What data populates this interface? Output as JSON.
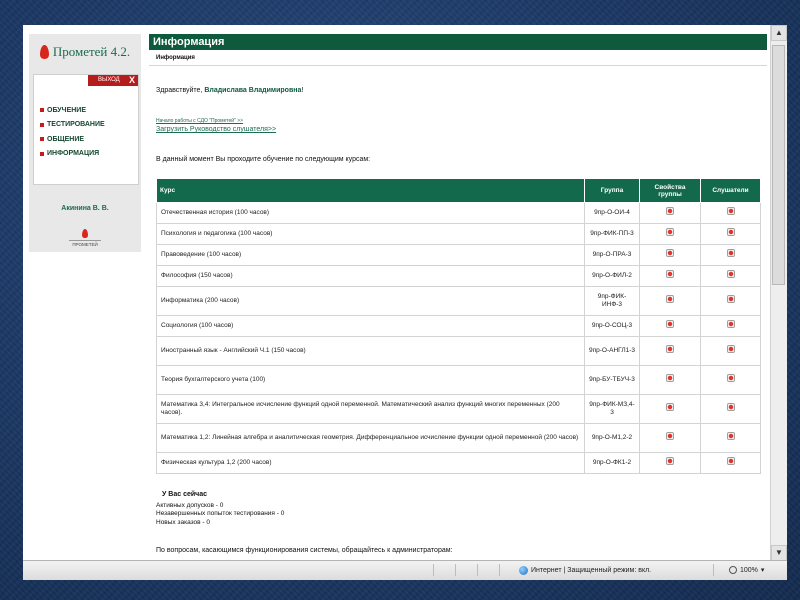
{
  "app": {
    "logo_text": "Прометей 4.2.",
    "small_logo_text": "ПРОМЕТЕЙ"
  },
  "sidebar": {
    "exit_label": "ВЫХОД",
    "exit_x": "X",
    "items": [
      {
        "label": "ОБУЧЕНИЕ"
      },
      {
        "label": "ТЕСТИРОВАНИЕ"
      },
      {
        "label": "ОБЩЕНИЕ"
      },
      {
        "label": "ИНФОРМАЦИЯ"
      }
    ],
    "user_name": "Акинина В. В."
  },
  "main": {
    "header_title": "Информация",
    "breadcrumb": "Информация",
    "greeting_prefix": "Здравствуйте, ",
    "greeting_name": "Владислава Владимировна",
    "greeting_suffix": "!",
    "link_start": "Начало работы с СДО \"Прометей\" >>",
    "link_guide": "Загрузить Руководство слушателя>>",
    "intro": "В данный момент Вы проходите обучение по следующим курсам:",
    "table": {
      "headers": {
        "course": "Курс",
        "group": "Группа",
        "group_props": "Свойства группы",
        "listeners": "Слушатели"
      },
      "rows": [
        {
          "course": "Отечественная история (100 часов)",
          "group": "9пр-О-ОИ-4"
        },
        {
          "course": "Психология и педагогика (100 часов)",
          "group": "9пр-ФИК-ПП-3"
        },
        {
          "course": "Правоведение (100 часов)",
          "group": "9пр-О-ПРА-3"
        },
        {
          "course": "Философия (150 часов)",
          "group": "9пр-О-ФИЛ-2"
        },
        {
          "course": "Информатика (200 часов)",
          "group": "9пр-ФИК-ИНФ-3"
        },
        {
          "course": "Социология (100 часов)",
          "group": "9пр-О-СОЦ-3"
        },
        {
          "course": "Иностранный язык - Английский Ч.1 (150 часов)",
          "group": "9пр-О-АНГЛ1-3"
        },
        {
          "course": "Теория бухгалтерского учета (100)",
          "group": "9пр-БУ-ТБУЧ-3"
        },
        {
          "course": "Математика 3,4: Интегральное исчисление функций одной переменной. Математический анализ функций многих переменных (200 часов).",
          "group": "9пр-ФИК-МЗ,4-3"
        },
        {
          "course": "Математика 1,2: Линейная алгебра и аналитическая геометрия. Дифференциальное исчисление функции одной переменной (200 часов)",
          "group": "9пр-О-М1,2-2"
        },
        {
          "course": "Физическая культура 1,2 (200 часов)",
          "group": "9пр-О-ФК1-2"
        }
      ]
    },
    "summary": {
      "title": "У Вас сейчас",
      "active": "Активных допусков - 0",
      "unfinished": "Незавершенных попыток тестирования - 0",
      "orders": "Новых заказов - 0"
    },
    "footer_note": "По вопросам, касающимся функционирования системы, обращайтесь к администраторам:"
  },
  "statusbar": {
    "zone": "Интернет | Защищенный режим: вкл.",
    "zoom": "100%"
  }
}
